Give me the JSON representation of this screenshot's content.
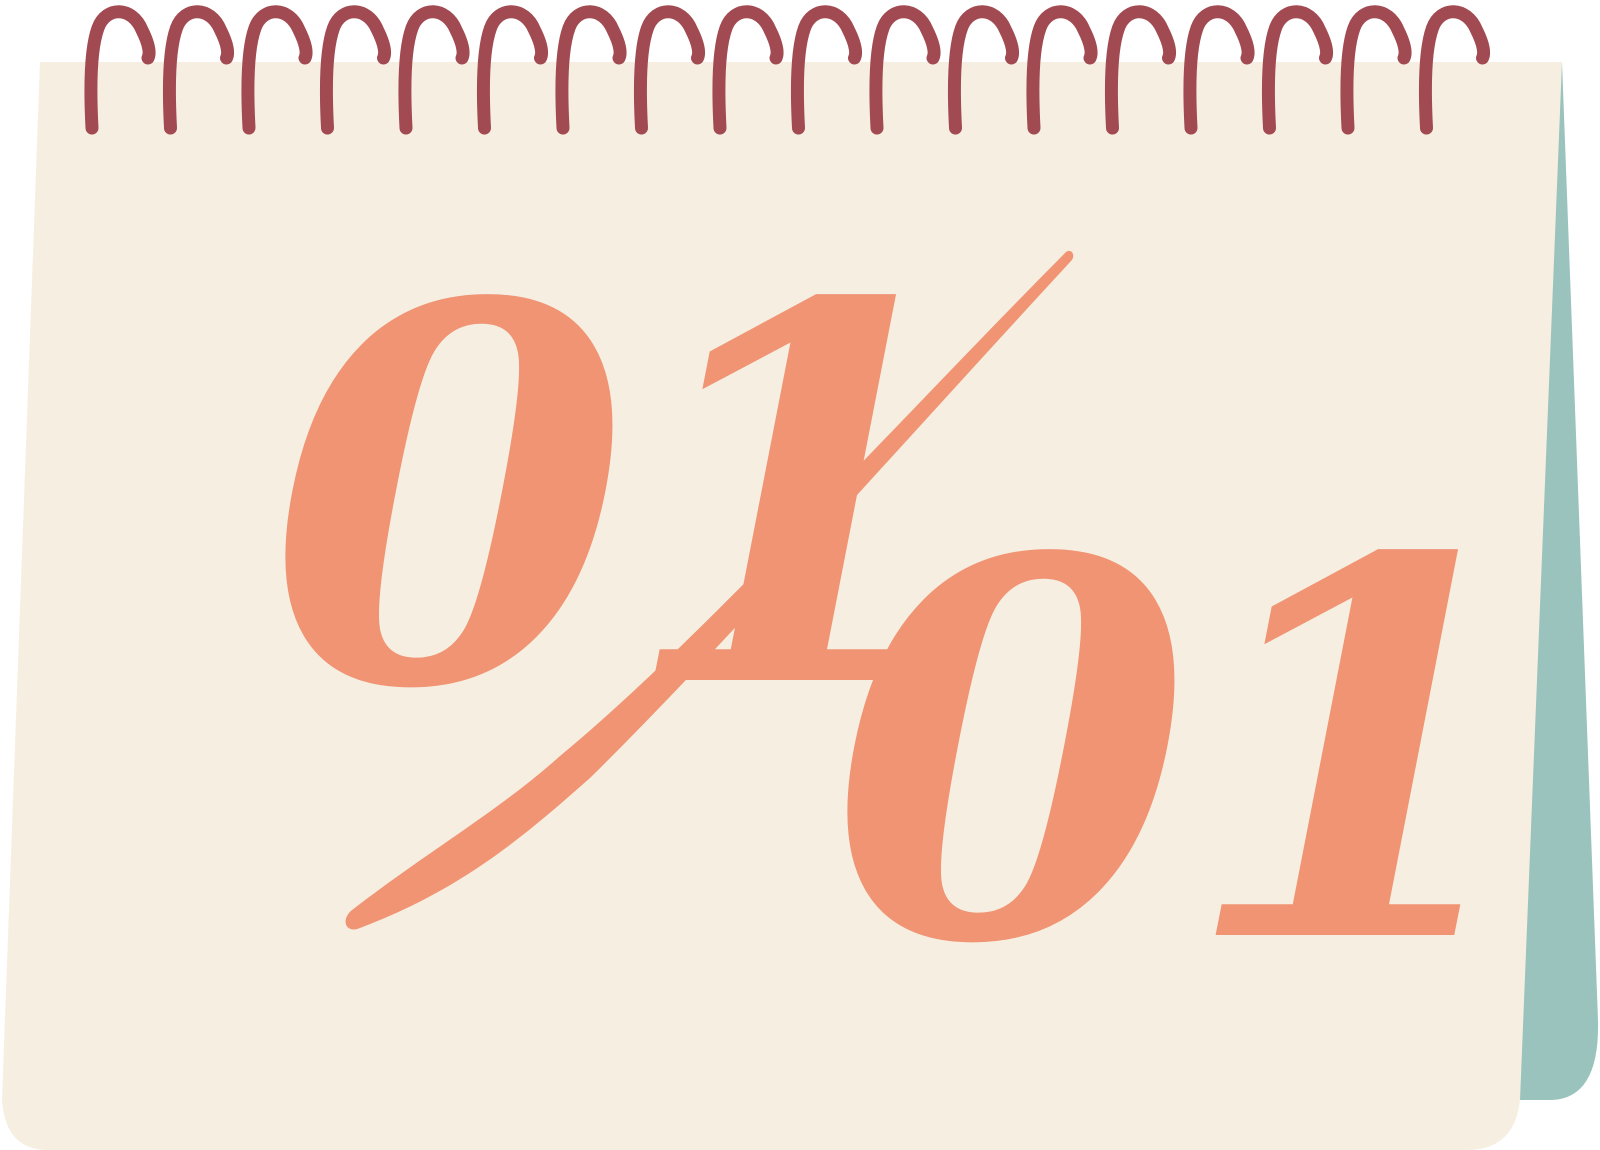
{
  "calendar": {
    "date_top": "01",
    "date_bottom": "01",
    "colors": {
      "page": "#F6EFE1",
      "back_cover": "#9AC3BD",
      "rings": "#A24A52",
      "numerals": "#F09474"
    },
    "icons": {
      "binding": "spiral-binding-icon",
      "slash": "slash-stroke-icon"
    }
  }
}
